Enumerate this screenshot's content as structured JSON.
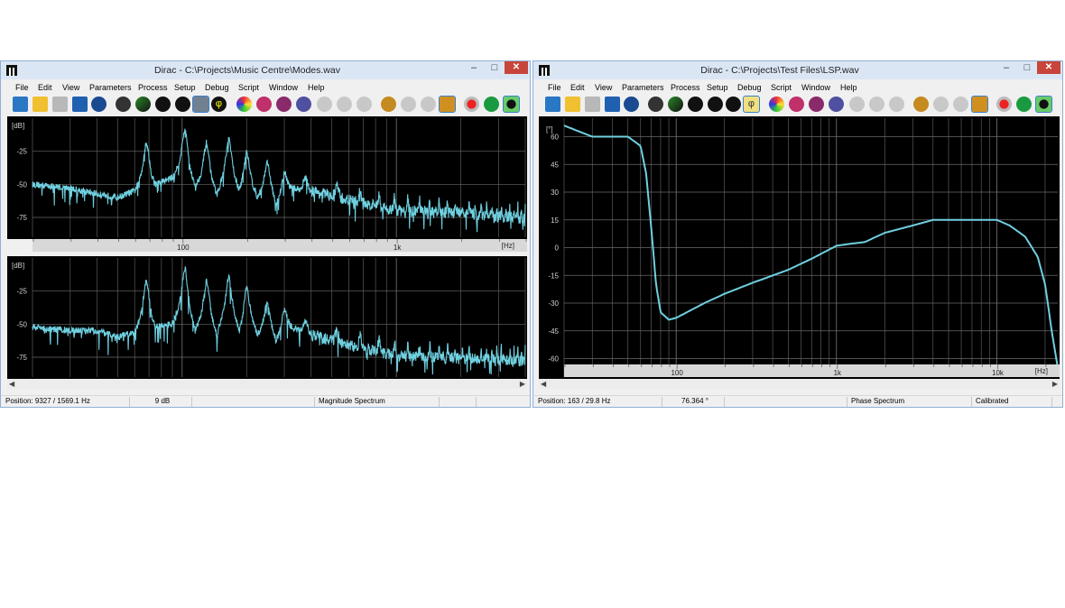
{
  "windows": [
    {
      "title": "Dirac - C:\\Projects\\Music Centre\\Modes.wav",
      "caption": {
        "minimize": "–",
        "maximize": "□",
        "close": "✕"
      },
      "menu": [
        "File",
        "Edit",
        "View",
        "Parameters",
        "Process",
        "Setup",
        "Debug",
        "Script",
        "Window",
        "Help"
      ],
      "toolbar_icons": [
        "new-file-icon",
        "open-file-icon",
        "save-icon",
        "print-icon",
        "wave-icon",
        "play-green-icon",
        "process-icon",
        "process-icon",
        "process-icon",
        "spectrum-icon",
        "phi-icon",
        "color-icon",
        "filter-icon",
        "grid-icon",
        "measure-icon",
        "zoom-icon",
        "zoom-icon",
        "zoom-icon",
        "zoom-icon",
        "add-icon",
        "remove-icon",
        "fit-icon",
        "info-icon",
        "record-icon",
        "play-icon",
        "stop-icon"
      ],
      "status": {
        "position": "Position: 9327 / 1569.1 Hz",
        "value": "9 dB",
        "blank": "",
        "mode": "Magnitude Spectrum",
        "cal": ""
      },
      "plots": [
        {
          "y_unit": "[dB]",
          "x_unit": "[Hz]"
        },
        {
          "y_unit": "[dB]",
          "x_unit": "[Hz]"
        }
      ]
    },
    {
      "title": "Dirac - C:\\Projects\\Test Files\\LSP.wav",
      "caption": {
        "minimize": "–",
        "maximize": "□",
        "close": "✕"
      },
      "menu": [
        "File",
        "Edit",
        "View",
        "Parameters",
        "Process",
        "Setup",
        "Debug",
        "Script",
        "Window",
        "Help"
      ],
      "toolbar_icons": [
        "new-file-icon",
        "open-file-icon",
        "save-icon",
        "print-icon",
        "wave-icon",
        "play-green-icon",
        "process-icon",
        "process-icon",
        "process-icon",
        "spectrum-icon",
        "phi-icon",
        "color-icon",
        "filter-icon",
        "grid-icon",
        "measure-icon",
        "zoom-icon",
        "zoom-icon",
        "zoom-icon",
        "zoom-icon",
        "add-icon",
        "remove-icon",
        "fit-icon",
        "info-icon",
        "record-icon",
        "play-icon",
        "stop-icon"
      ],
      "status": {
        "position": "Position: 163 / 29.8 Hz",
        "value": "76.364 °",
        "blank": "",
        "mode": "Phase Spectrum",
        "cal": "Calibrated"
      },
      "plots": [
        {
          "y_unit": "[°]",
          "x_unit": "[Hz]"
        }
      ]
    }
  ],
  "chart_data": [
    {
      "type": "line",
      "title": "",
      "xlabel": "[Hz]",
      "ylabel": "[dB]",
      "x_scale": "log",
      "xlim": [
        20,
        4000
      ],
      "ylim": [
        -90,
        0
      ],
      "x_ticks": [
        "100",
        "1k"
      ],
      "y_ticks": [
        "-25",
        "-50",
        "-75"
      ],
      "grid": true,
      "color": "#6fd0e0",
      "peaks_hz": [
        68,
        103,
        130,
        165,
        200,
        250,
        300
      ],
      "series": [
        {
          "x": [
            20,
            30,
            40,
            50,
            60,
            68,
            75,
            90,
            103,
            115,
            130,
            145,
            165,
            185,
            200,
            225,
            250,
            275,
            300,
            400,
            600,
            1000,
            2000,
            4000
          ],
          "y": [
            -50,
            -53,
            -57,
            -60,
            -55,
            -36,
            -50,
            -45,
            -25,
            -52,
            -34,
            -58,
            -30,
            -55,
            -38,
            -60,
            -45,
            -65,
            -52,
            -55,
            -62,
            -70,
            -72,
            -76
          ]
        }
      ]
    },
    {
      "type": "line",
      "title": "",
      "xlabel": "[Hz]",
      "ylabel": "[dB]",
      "x_scale": "log",
      "xlim": [
        20,
        4000
      ],
      "ylim": [
        -90,
        0
      ],
      "x_ticks": [],
      "y_ticks": [
        "-25",
        "-50",
        "-75"
      ],
      "grid": true,
      "color": "#6fd0e0",
      "peaks_hz": [
        68,
        103,
        130,
        165,
        200,
        250,
        300
      ],
      "series": [
        {
          "x": [
            20,
            30,
            40,
            50,
            60,
            68,
            75,
            90,
            103,
            115,
            130,
            145,
            165,
            185,
            200,
            225,
            250,
            275,
            300,
            400,
            600,
            1000,
            2000,
            4000
          ],
          "y": [
            -52,
            -55,
            -55,
            -60,
            -56,
            -35,
            -52,
            -50,
            -24,
            -55,
            -33,
            -58,
            -28,
            -56,
            -36,
            -58,
            -45,
            -62,
            -50,
            -58,
            -66,
            -74,
            -76,
            -78
          ]
        }
      ]
    },
    {
      "type": "line",
      "title": "",
      "xlabel": "[Hz]",
      "ylabel": "[°]",
      "x_scale": "log",
      "xlim": [
        20,
        24000
      ],
      "ylim": [
        -70,
        70
      ],
      "x_ticks": [
        "100",
        "1k",
        "10k"
      ],
      "y_ticks": [
        "60",
        "45",
        "30",
        "15",
        "0",
        "-15",
        "-30",
        "-45",
        "-60"
      ],
      "grid": true,
      "color": "#6fd0e0",
      "series": [
        {
          "x": [
            20,
            30,
            40,
            50,
            60,
            65,
            70,
            75,
            80,
            90,
            100,
            150,
            200,
            300,
            500,
            700,
            1000,
            1200,
            1500,
            2000,
            3000,
            4000,
            5000,
            7000,
            10000,
            12000,
            15000,
            18000,
            20000,
            22000,
            24000
          ],
          "y": [
            66,
            60,
            60,
            60,
            55,
            40,
            10,
            -20,
            -35,
            -39,
            -38,
            -30,
            -25,
            -19,
            -12,
            -6,
            1,
            2,
            3,
            8,
            12,
            15,
            15,
            15,
            15,
            12,
            6,
            -5,
            -20,
            -45,
            -65
          ]
        }
      ]
    }
  ]
}
